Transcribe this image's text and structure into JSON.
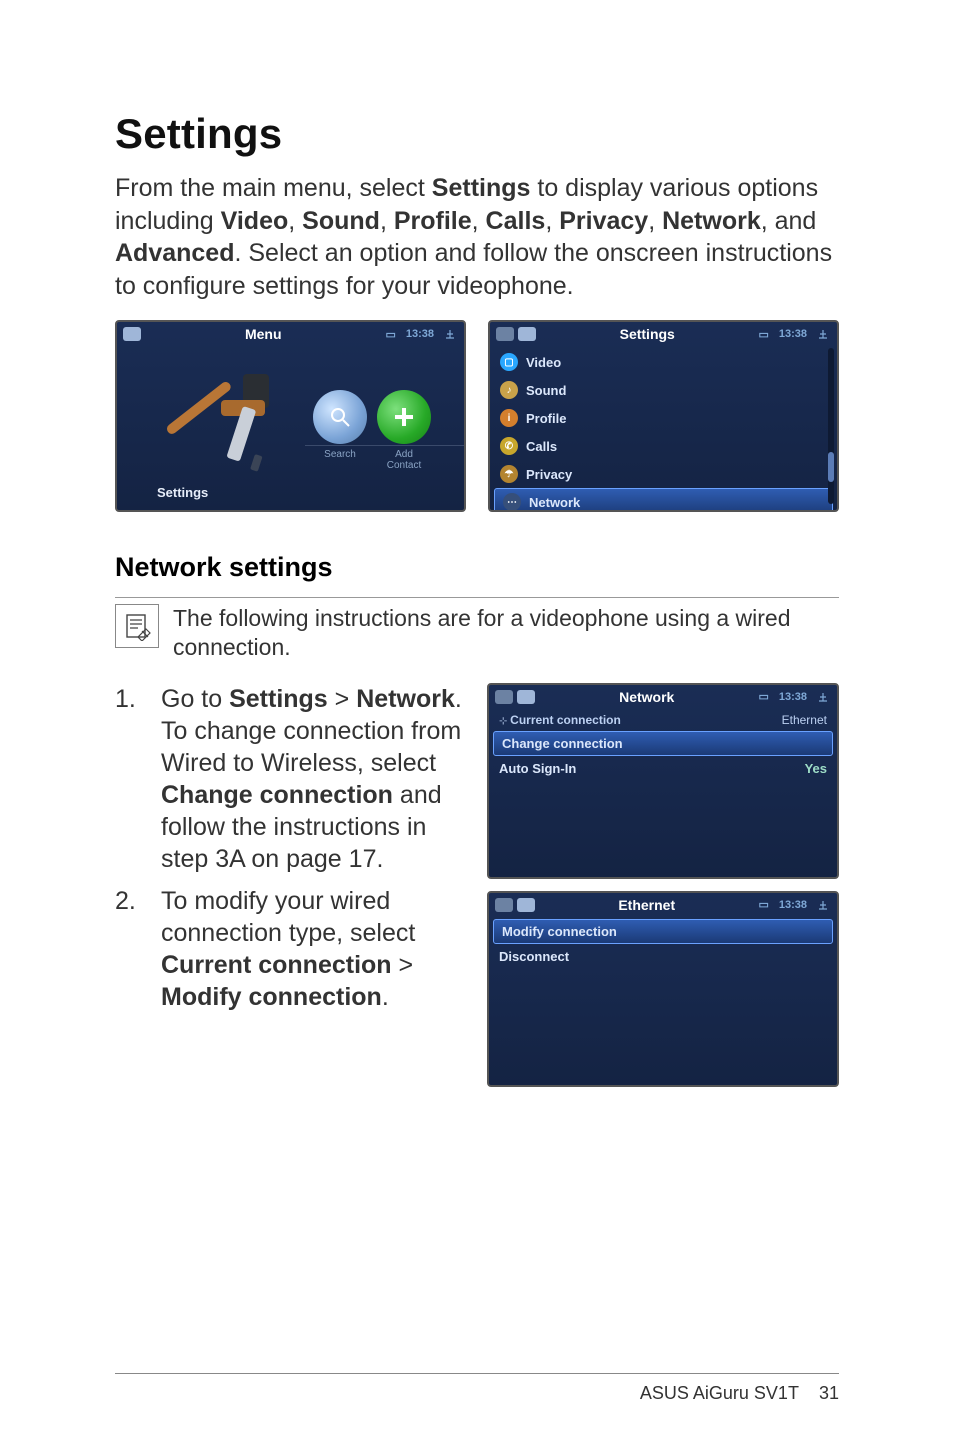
{
  "page": {
    "title": "Settings",
    "intro_parts": [
      "From the main menu, select ",
      "Settings",
      " to display various options including ",
      "Video",
      ", ",
      "Sound",
      ", ",
      "Profile",
      ", ",
      "Calls",
      ", ",
      "Privacy",
      ", ",
      "Network",
      ", and ",
      "Advanced",
      ". Select an option and follow the onscreen instructions to configure settings for your videophone."
    ]
  },
  "screenshot_menu": {
    "header_title": "Menu",
    "time": "13:38",
    "selected_label": "Settings",
    "small_search": "Search",
    "small_add": "Add Contact"
  },
  "screenshot_settings_list": {
    "header_title": "Settings",
    "time": "13:38",
    "items": [
      {
        "icon_color": "#2aa7ff",
        "glyph": "▢",
        "label": "Video"
      },
      {
        "icon_color": "#c9a24a",
        "glyph": "♪",
        "label": "Sound"
      },
      {
        "icon_color": "#d47f2d",
        "glyph": "i",
        "label": "Profile"
      },
      {
        "icon_color": "#c7a62c",
        "glyph": "✆",
        "label": "Calls"
      },
      {
        "icon_color": "#b38430",
        "glyph": "☂",
        "label": "Privacy"
      },
      {
        "icon_color": "#364f7a",
        "glyph": "⋯",
        "label": "Network",
        "selected": true
      }
    ]
  },
  "section_network": {
    "title": "Network settings",
    "note": "The following instructions are for a videophone using a wired connection.",
    "steps": [
      {
        "num": "1.",
        "text_parts": [
          "Go to ",
          "Settings",
          " > ",
          "Network",
          ". To change connection from Wired to Wireless, select ",
          "Change connection",
          " and follow the instructions in step 3A on page 17."
        ]
      },
      {
        "num": "2.",
        "text_parts": [
          "To modify your wired connection type, select ",
          "Current connection",
          " > ",
          "Modify connection",
          "."
        ]
      }
    ]
  },
  "screenshot_network": {
    "header_title": "Network",
    "time": "13:38",
    "sub_left": "Current connection",
    "sub_right": "Ethernet",
    "items": [
      {
        "label": "Change connection",
        "selected": true
      },
      {
        "label": "Auto Sign-In",
        "value": "Yes"
      }
    ]
  },
  "screenshot_ethernet": {
    "header_title": "Ethernet",
    "time": "13:38",
    "items": [
      {
        "label": "Modify connection",
        "selected": true
      },
      {
        "label": "Disconnect"
      }
    ]
  },
  "footer": {
    "product": "ASUS AiGuru SV1T",
    "page_number": "31"
  }
}
